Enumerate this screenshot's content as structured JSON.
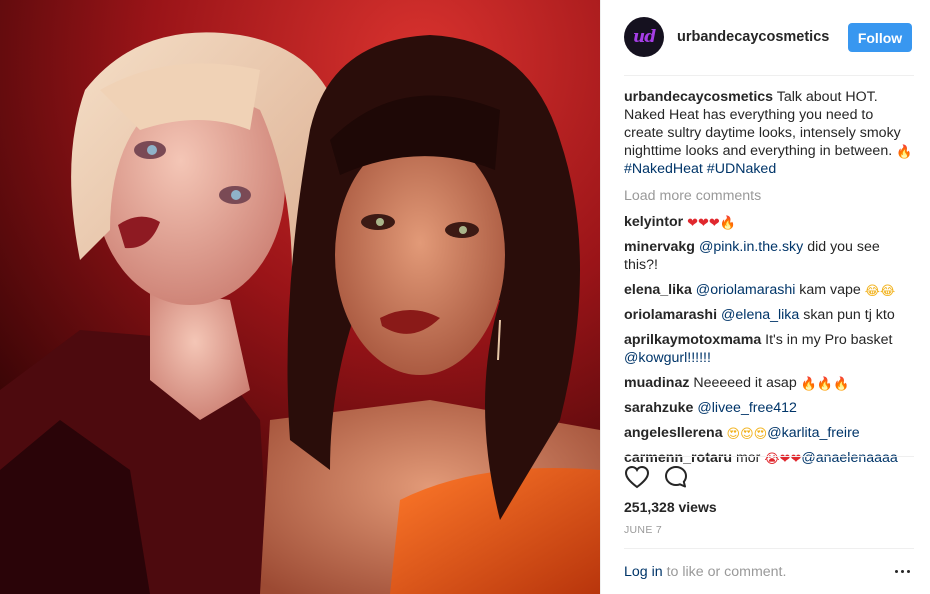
{
  "post": {
    "image_alt": "Two models with red-toned makeup",
    "username": "urbandecaycosmetics",
    "avatar_text": "ud",
    "follow_label": "Follow",
    "caption_user": "urbandecaycosmetics",
    "caption_text": " Talk about HOT. Naked Heat has everything you need to create sultry daytime looks, intensely smoky nighttime looks and everything in between. ",
    "caption_emoji": "🔥",
    "caption_tags": "#NakedHeat #UDNaked",
    "load_more": "Load more comments",
    "comments": [
      {
        "user": "kelyintor",
        "pre": " ",
        "mention": "",
        "post": "",
        "emoji": "❤❤❤🔥",
        "emoji_class": "heart",
        "mention2": ""
      },
      {
        "user": "minervakg",
        "pre": " ",
        "mention": "@pink.in.the.sky",
        "post": " did you see this?!",
        "emoji": "",
        "emoji_class": "",
        "mention2": ""
      },
      {
        "user": "elena_lika",
        "pre": " ",
        "mention": "@oriolamarashi",
        "post": " kam vape ",
        "emoji": "😂😂",
        "emoji_class": "smile",
        "mention2": ""
      },
      {
        "user": "oriolamarashi",
        "pre": " ",
        "mention": "@elena_lika",
        "post": " skan pun tj kto",
        "emoji": "",
        "emoji_class": "",
        "mention2": ""
      },
      {
        "user": "aprilkaymotoxmama",
        "pre": " It's in my Pro basket ",
        "mention": "@kowgurl!!!!!!",
        "post": "",
        "emoji": "",
        "emoji_class": "",
        "mention2": ""
      },
      {
        "user": "muadinaz",
        "pre": " Neeeeed it asap ",
        "mention": "",
        "post": "",
        "emoji": "🔥🔥🔥",
        "emoji_class": "fire",
        "mention2": ""
      },
      {
        "user": "sarahzuke",
        "pre": " ",
        "mention": "@livee_free412",
        "post": "",
        "emoji": "",
        "emoji_class": "",
        "mention2": ""
      },
      {
        "user": "angelesllerena",
        "pre": " ",
        "mention": "",
        "post": "",
        "emoji": "😍😍😍",
        "emoji_class": "smile",
        "mention2": "@karlita_freire"
      },
      {
        "user": "carmenn_rotaru",
        "pre": " mor ",
        "mention": "",
        "post": "",
        "emoji": "😭❤❤",
        "emoji_class": "heart",
        "mention2": "@anaelenaaaa"
      }
    ],
    "views": "251,328 views",
    "date": "JUNE 7",
    "login_link": "Log in",
    "login_text": " to like or comment."
  },
  "colors": {
    "accent": "#3897f0",
    "link": "#003569",
    "muted": "#999999",
    "heart": "#e0282e"
  },
  "icons": [
    "heart-outline-icon",
    "comment-icon",
    "more-dots-icon"
  ]
}
